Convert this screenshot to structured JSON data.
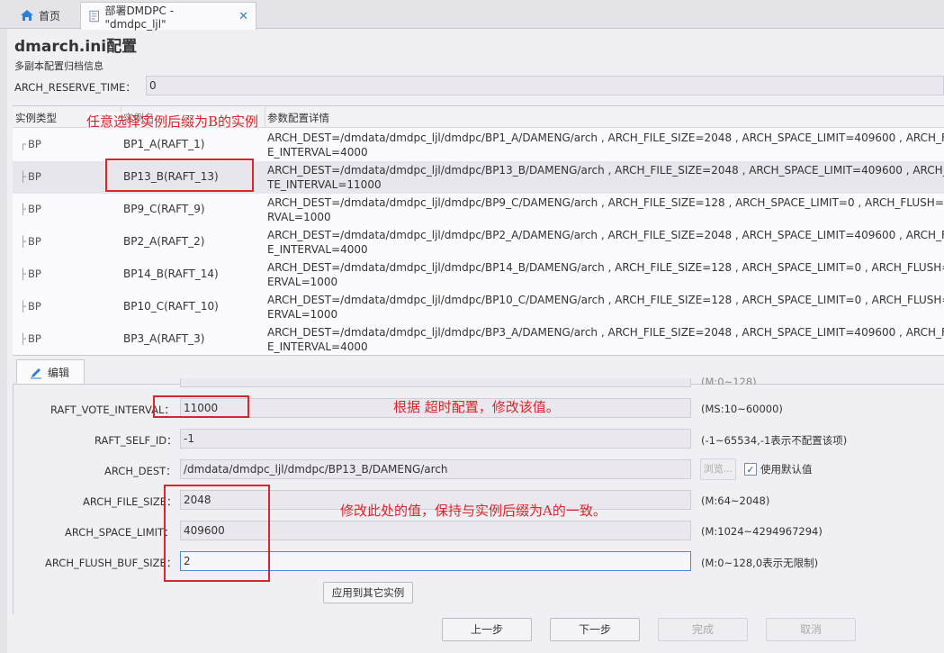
{
  "tabs": {
    "home": "首页",
    "active": "部署DMDPC - \"dmdpc_ljl\""
  },
  "header": {
    "title": "dmarch.ini配置",
    "subtitle": "多副本配置归档信息"
  },
  "reserve": {
    "label": "ARCH_RESERVE_TIME：",
    "value": "0"
  },
  "table": {
    "columns": [
      "实例类型",
      "实例名",
      "参数配置详情"
    ],
    "rows": [
      {
        "type": "BP",
        "name": "BP1_A(RAFT_1)",
        "detail1": "ARCH_DEST=/dmdata/dmdpc_ljl/dmdpc/BP1_A/DAMENG/arch , ARCH_FILE_SIZE=2048 , ARCH_SPACE_LIMIT=409600 , ARCH_FLUSH",
        "detail2": "E_INTERVAL=4000"
      },
      {
        "type": "BP",
        "name": "BP13_B(RAFT_13)",
        "detail1": "ARCH_DEST=/dmdata/dmdpc_ljl/dmdpc/BP13_B/DAMENG/arch , ARCH_FILE_SIZE=2048 , ARCH_SPACE_LIMIT=409600 , ARCH_FLUSH",
        "detail2": "TE_INTERVAL=11000"
      },
      {
        "type": "BP",
        "name": "BP9_C(RAFT_9)",
        "detail1": "ARCH_DEST=/dmdata/dmdpc_ljl/dmdpc/BP9_C/DAMENG/arch , ARCH_FILE_SIZE=128 , ARCH_SPACE_LIMIT=0 , ARCH_FLUSH=0,XM",
        "detail2": "RVAL=1000"
      },
      {
        "type": "BP",
        "name": "BP2_A(RAFT_2)",
        "detail1": "ARCH_DEST=/dmdata/dmdpc_ljl/dmdpc/BP2_A/DAMENG/arch , ARCH_FILE_SIZE=2048 , ARCH_SPACE_LIMIT=409600 , ARCH_FLUSH",
        "detail2": "E_INTERVAL=4000"
      },
      {
        "type": "BP",
        "name": "BP14_B(RAFT_14)",
        "detail1": "ARCH_DEST=/dmdata/dmdpc_ljl/dmdpc/BP14_B/DAMENG/arch , ARCH_FILE_SIZE=128 , ARCH_SPACE_LIMIT=0 , ARCH_FLUSH=0,X",
        "detail2": "ERVAL=1000"
      },
      {
        "type": "BP",
        "name": "BP10_C(RAFT_10)",
        "detail1": "ARCH_DEST=/dmdata/dmdpc_ljl/dmdpc/BP10_C/DAMENG/arch , ARCH_FILE_SIZE=128 , ARCH_SPACE_LIMIT=0 , ARCH_FLUSH=0,X",
        "detail2": "ERVAL=1000"
      },
      {
        "type": "BP",
        "name": "BP3_A(RAFT_3)",
        "detail1": "ARCH_DEST=/dmdata/dmdpc_ljl/dmdpc/BP3_A/DAMENG/arch , ARCH_FILE_SIZE=2048 , ARCH_SPACE_LIMIT=409600 , ARCH_FLUS",
        "detail2": "E_INTERVAL=4000"
      }
    ]
  },
  "edit": {
    "tab_label": "编辑",
    "partial_hint": "(M:0~128)",
    "raft_vote_interval": {
      "label": "RAFT_VOTE_INTERVAL：",
      "value": "11000",
      "hint": "(MS:10~60000)"
    },
    "raft_self_id": {
      "label": "RAFT_SELF_ID：",
      "value": "-1",
      "hint": "(-1~65534,-1表示不配置该项)"
    },
    "arch_dest": {
      "label": "ARCH_DEST：",
      "value": "/dmdata/dmdpc_ljl/dmdpc/BP13_B/DAMENG/arch",
      "browse": "浏览...",
      "use_default": "使用默认值"
    },
    "arch_file_size": {
      "label": "ARCH_FILE_SIZE：",
      "value": "2048",
      "hint": "(M:64~2048)"
    },
    "arch_space_limit": {
      "label": "ARCH_SPACE_LIMIT：",
      "value": "409600",
      "hint": "(M:1024~4294967294)"
    },
    "arch_flush_buf_size": {
      "label": "ARCH_FLUSH_BUF_SIZE：",
      "value": "2",
      "hint": "(M:0~128,0表示无限制)"
    },
    "apply_button": "应用到其它实例"
  },
  "footer": {
    "prev": "上一步",
    "next": "下一步",
    "finish": "完成",
    "cancel": "取消"
  },
  "annotations": {
    "select_b": "任意选择实例后缀为B的实例",
    "timeout": "根据 超时配置，修改该值。",
    "match_a": "修改此处的值，保持与实例后缀为A的一致。"
  },
  "colors": {
    "annotation_red": "#d9262a",
    "accent_blue": "#2f7fd6"
  }
}
